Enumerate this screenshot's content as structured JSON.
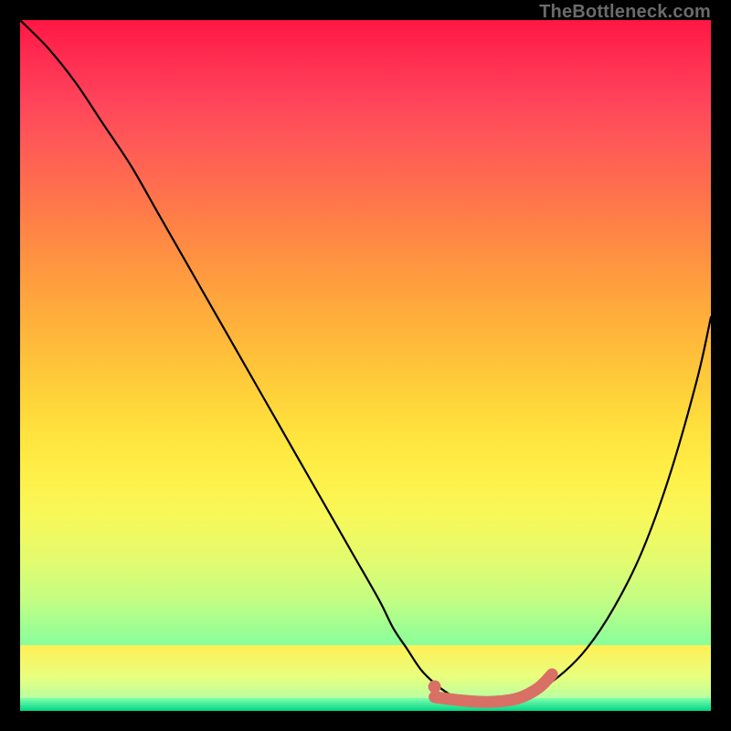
{
  "watermark": "TheBottleneck.com",
  "colors": {
    "curve": "#000000",
    "marker": "#d97066",
    "frame": "#000000"
  },
  "chart_data": {
    "type": "line",
    "title": "",
    "xlabel": "",
    "ylabel": "",
    "xlim": [
      0,
      100
    ],
    "ylim": [
      0,
      100
    ],
    "grid": false,
    "legend": false,
    "x": [
      0,
      4,
      8,
      12,
      16,
      20,
      24,
      28,
      32,
      36,
      40,
      44,
      48,
      52,
      54,
      56,
      58,
      60,
      62,
      64,
      66,
      68,
      70,
      74,
      78,
      82,
      86,
      90,
      94,
      98,
      100
    ],
    "y": [
      100,
      96,
      91,
      85,
      79,
      72,
      65,
      58,
      51,
      44,
      37,
      30,
      23,
      16,
      12,
      9,
      6,
      4,
      2.5,
      1.5,
      1,
      1,
      1.2,
      2.5,
      5,
      9,
      15,
      23,
      34,
      48,
      57
    ],
    "series": [
      {
        "name": "bottleneck-curve",
        "x": [
          0,
          4,
          8,
          12,
          16,
          20,
          24,
          28,
          32,
          36,
          40,
          44,
          48,
          52,
          54,
          56,
          58,
          60,
          62,
          64,
          66,
          68,
          70,
          74,
          78,
          82,
          86,
          90,
          94,
          98,
          100
        ],
        "y": [
          100,
          96,
          91,
          85,
          79,
          72,
          65,
          58,
          51,
          44,
          37,
          30,
          23,
          16,
          12,
          9,
          6,
          4,
          2.5,
          1.5,
          1,
          1,
          1.2,
          2.5,
          5,
          9,
          15,
          23,
          34,
          48,
          57
        ]
      }
    ],
    "optimal_marker": {
      "dot": {
        "x": 60,
        "y": 3.5
      },
      "band": [
        {
          "x": 60,
          "y": 2.0
        },
        {
          "x": 64,
          "y": 1.5
        },
        {
          "x": 68,
          "y": 1.3
        },
        {
          "x": 72,
          "y": 1.8
        },
        {
          "x": 75,
          "y": 3.3
        },
        {
          "x": 77,
          "y": 5.3
        }
      ]
    }
  }
}
